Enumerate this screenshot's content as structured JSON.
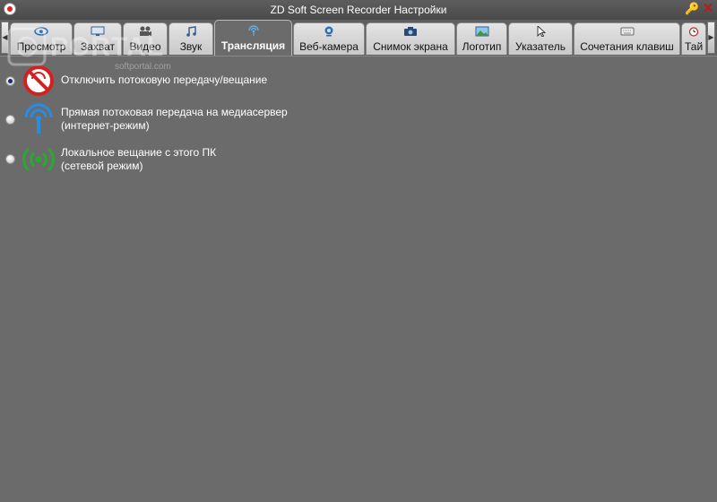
{
  "window": {
    "title": "ZD Soft Screen Recorder Настройки",
    "icons": {
      "app": "record-icon",
      "key": "key-icon",
      "close": "close-icon"
    }
  },
  "tabs": [
    {
      "label": "Просмотр",
      "icon": "eye-icon"
    },
    {
      "label": "Захват",
      "icon": "monitor-icon"
    },
    {
      "label": "Видео",
      "icon": "video-camera-icon"
    },
    {
      "label": "Звук",
      "icon": "music-note-icon"
    },
    {
      "label": "Трансляция",
      "icon": "broadcast-icon",
      "active": true
    },
    {
      "label": "Веб-камера",
      "icon": "webcam-icon"
    },
    {
      "label": "Снимок экрана",
      "icon": "photo-camera-icon"
    },
    {
      "label": "Логотип",
      "icon": "picture-icon"
    },
    {
      "label": "Указатель",
      "icon": "cursor-icon"
    },
    {
      "label": "Сочетания клавиш",
      "icon": "keyboard-icon"
    },
    {
      "label": "Тай",
      "icon": "alarm-clock-icon"
    }
  ],
  "options": [
    {
      "line1": "Отключить потоковую передачу/вещание",
      "line2": "",
      "checked": true,
      "icon": "no-broadcast-icon",
      "color": "#d42020"
    },
    {
      "line1": "Прямая потоковая передача на медиасервер",
      "line2": "(интернет-режим)",
      "checked": false,
      "icon": "antenna-icon",
      "color": "#2a8be0"
    },
    {
      "line1": "Локальное вещание с этого ПК",
      "line2": "(сетевой режим)",
      "checked": false,
      "icon": "wifi-broadcast-icon",
      "color": "#2aa830"
    }
  ],
  "watermark": {
    "brand": "PORTAL",
    "domain": "softportal.com"
  }
}
